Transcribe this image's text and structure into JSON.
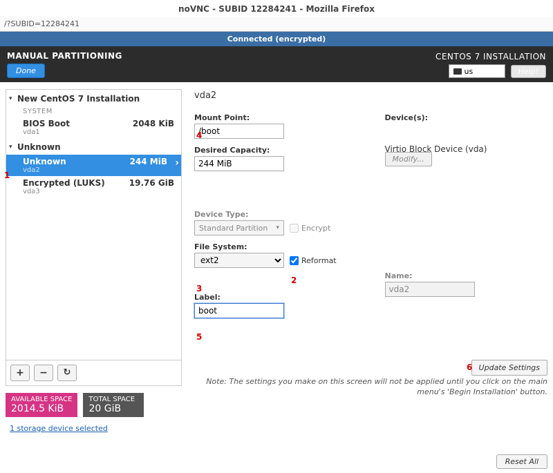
{
  "window": {
    "title": "noVNC - SUBID 12284241 - Mozilla Firefox",
    "url": "/?SUBID=12284241"
  },
  "vnc": {
    "status": "Connected (encrypted)"
  },
  "topbar": {
    "title": "MANUAL PARTITIONING",
    "done": "Done",
    "install_title": "CENTOS 7 INSTALLATION",
    "lang": "us",
    "help": "Help!"
  },
  "tree": {
    "group1": "New CentOS 7 Installation",
    "sys_label": "SYSTEM",
    "items1": [
      {
        "title": "BIOS Boot",
        "dev": "vda1",
        "size": "2048 KiB"
      }
    ],
    "group2": "Unknown",
    "items2": [
      {
        "title": "Unknown",
        "dev": "vda2",
        "size": "244 MiB"
      },
      {
        "title": "Encrypted (LUKS)",
        "dev": "vda3",
        "size": "19.76 GiB"
      }
    ],
    "tb_add": "+",
    "tb_remove": "−",
    "tb_reload": "↻"
  },
  "badges": {
    "avail_label": "AVAILABLE SPACE",
    "avail_value": "2014.5 KiB",
    "total_label": "TOTAL SPACE",
    "total_value": "20 GiB"
  },
  "storage_link": "1 storage device selected",
  "panel": {
    "device_heading": "vda2",
    "mount_label": "Mount Point:",
    "mount_value": "/boot",
    "capacity_label": "Desired Capacity:",
    "capacity_value": "244 MiB",
    "devices_label": "Device(s):",
    "device_desc": "Virtio Block Device (vda)",
    "modify": "Modify...",
    "device_type_label": "Device Type:",
    "device_type_value": "Standard Partition",
    "encrypt_label": "Encrypt",
    "fs_label": "File System:",
    "fs_value": "ext2",
    "reformat_label": "Reformat",
    "label_label": "Label:",
    "label_value": "boot",
    "name_label": "Name:",
    "name_value": "vda2",
    "update": "Update Settings",
    "note": "Note:  The settings you make on this screen will not be applied until you click on the main menu's 'Begin Installation' button."
  },
  "reset": "Reset All",
  "annotations": {
    "a1": "1",
    "a2": "2",
    "a3": "3",
    "a4": "4",
    "a5": "5",
    "a6": "6"
  }
}
